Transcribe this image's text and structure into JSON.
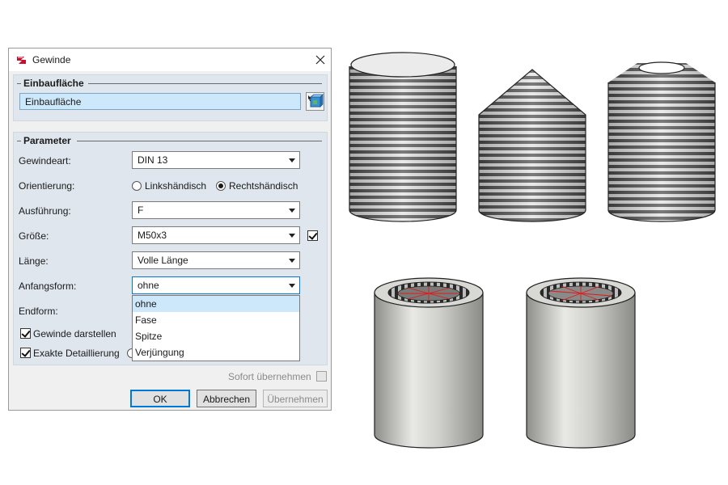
{
  "dialog": {
    "title": "Gewinde",
    "app_icon": "hicad-logo-icon",
    "close_icon": "close-icon"
  },
  "einbauflaeche": {
    "header": "Einbaufläche",
    "field_value": "Einbaufläche",
    "pick_icon": "select-surface-icon"
  },
  "parameter": {
    "header": "Parameter",
    "gewindeart": {
      "label": "Gewindeart:",
      "value": "DIN 13"
    },
    "orientierung": {
      "label": "Orientierung:",
      "options": [
        "Linkshändisch",
        "Rechtshändisch"
      ],
      "selected": "Rechtshändisch"
    },
    "ausfuehrung": {
      "label": "Ausführung:",
      "value": "F"
    },
    "groesse": {
      "label": "Größe:",
      "value": "M50x3",
      "checked": true
    },
    "laenge": {
      "label": "Länge:",
      "value": "Volle Länge"
    },
    "anfangsform": {
      "label": "Anfangsform:",
      "value": "ohne",
      "options": [
        "ohne",
        "Fase",
        "Spitze",
        "Verjüngung"
      ],
      "highlighted": "ohne"
    },
    "endform": {
      "label": "Endform:"
    },
    "gewinde_darstellen": {
      "label": "Gewinde darstellen",
      "checked": true
    },
    "exakte_detaillierung": {
      "label": "Exakte Detaillierung",
      "checked": true
    }
  },
  "footer": {
    "sofort_label": "Sofort übernehmen",
    "sofort_checked": false,
    "ok_label": "OK",
    "cancel_label": "Abbrechen",
    "apply_label": "Übernehmen"
  },
  "views": [
    {
      "name": "bolt-thread-flat-end",
      "ending": "ohne"
    },
    {
      "name": "bolt-thread-pointed-end",
      "ending": "Spitze"
    },
    {
      "name": "bolt-thread-chamfer-end",
      "ending": "Fase"
    },
    {
      "name": "nut-internal-thread-a"
    },
    {
      "name": "nut-internal-thread-b"
    }
  ],
  "colors": {
    "panel_bg": "#dfe6ee",
    "field_blue": "#cde8fa",
    "accent": "#0078d7",
    "thread_dark": "#3a3a3a",
    "thread_light": "#f2f2f2",
    "metal": "#c9c9c7",
    "cut_line": "#e0191b"
  }
}
